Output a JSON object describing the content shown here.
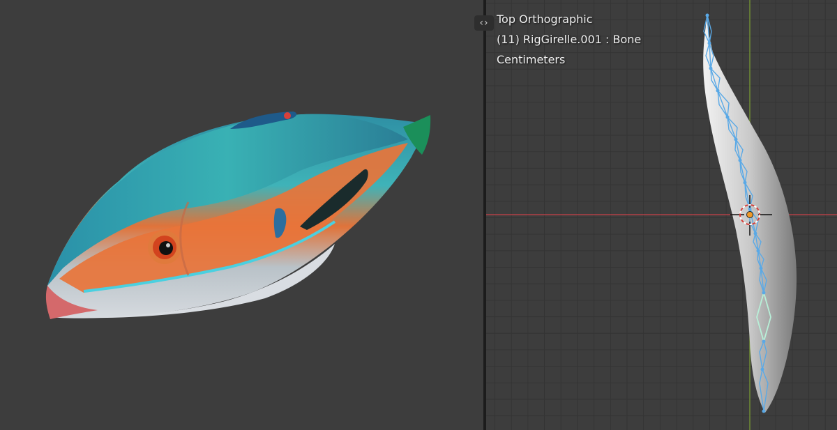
{
  "viewport_left": {
    "background": "#3d3d3d"
  },
  "viewport_right": {
    "view_name": "Top Orthographic",
    "object_info": "(11) RigGirelle.001 : Bone",
    "units": "Centimeters",
    "background": "#3d3d3d",
    "x_axis_color": "#c8414a",
    "y_axis_color": "#7aa033",
    "bone_color": "#5aa9e6",
    "active_bone_color": "#b8f0d8"
  },
  "toggle": {
    "icon": "chevrons-left-right-icon",
    "glyph": "‹›"
  }
}
